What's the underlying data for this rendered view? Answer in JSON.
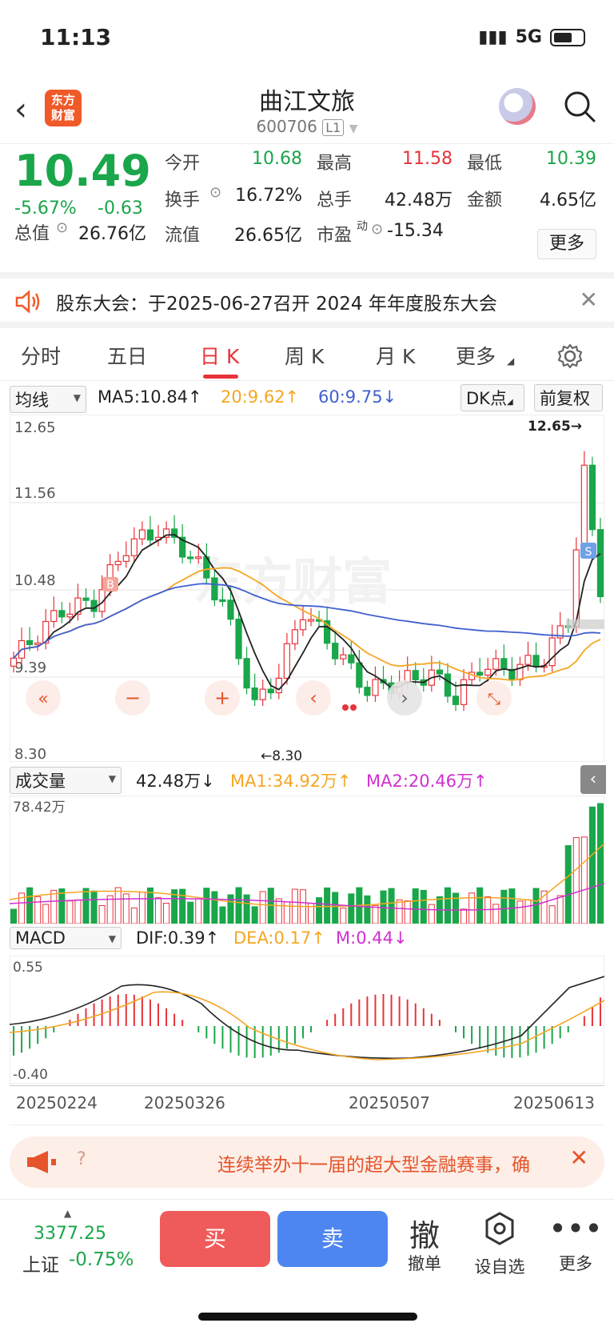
{
  "status": {
    "time": "11:13",
    "network": "5G"
  },
  "header": {
    "title": "曲江文旅",
    "code": "600706",
    "level": "L1",
    "logo_text": "东方财富"
  },
  "quote": {
    "price": "10.49",
    "change_pct": "-5.67%",
    "change": "-0.63",
    "open_label": "今开",
    "open": "10.68",
    "high_label": "最高",
    "high": "11.58",
    "low_label": "最低",
    "low": "10.39",
    "turnover_label": "换手",
    "turnover": "16.72%",
    "volume_label": "总手",
    "volume": "42.48万",
    "amount_label": "金额",
    "amount": "4.65亿",
    "mcap_label": "总值",
    "mcap": "26.76亿",
    "float_label": "流值",
    "float": "26.65亿",
    "pe_label": "市盈",
    "pe_sup": "动",
    "pe": "-15.34",
    "more": "更多"
  },
  "notice": {
    "text": "股东大会：于2025-06-27召开 2024 年年度股东大会"
  },
  "tabs": [
    {
      "label": "分时"
    },
    {
      "label": "五日"
    },
    {
      "label": "日 K"
    },
    {
      "label": "周 K"
    },
    {
      "label": "月 K"
    },
    {
      "label": "更多"
    }
  ],
  "ma_bar": {
    "selector": "均线",
    "ma5": "MA5:10.84↑",
    "ma20": "20:9.62↑",
    "ma60": "60:9.75↓",
    "dk": "DK点",
    "adjust": "前复权"
  },
  "vol_bar": {
    "selector": "成交量",
    "vol": "42.48万↓",
    "ma1": "MA1:34.92万↑",
    "ma2": "MA2:20.46万↑",
    "max": "78.42万"
  },
  "macd_bar": {
    "selector": "MACD",
    "dif": "DIF:0.39↑",
    "dea": "DEA:0.17↑",
    "m": "M:0.44↓",
    "top": "0.55",
    "bottom": "-0.40"
  },
  "kline": {
    "axis_top": "12.65",
    "axis_1": "11.56",
    "axis_2": "10.48",
    "axis_3": "9.39",
    "axis_bottom": "8.30",
    "high_mark": "12.65",
    "low_mark": "8.30",
    "watermark": "东方财富",
    "buy_mark": "B",
    "sell_mark": "S"
  },
  "dates": [
    "20250224",
    "20250326",
    "20250507",
    "20250613"
  ],
  "banner": {
    "q": "?",
    "text": "连续举办十一届的超大型金融赛事，确"
  },
  "bottom": {
    "index_value": "3377.25",
    "index_name": "上证",
    "index_pct": "-0.75%",
    "buy": "买",
    "sell": "卖",
    "cancel_icon": "撤",
    "cancel": "撤单",
    "watch": "设自选",
    "more": "更多"
  },
  "colors": {
    "up": "#e8333a",
    "down": "#1aa64a",
    "ma5": "#222222",
    "ma20": "#f5a623",
    "ma60": "#4060d0",
    "brand": "#f05a28"
  }
}
